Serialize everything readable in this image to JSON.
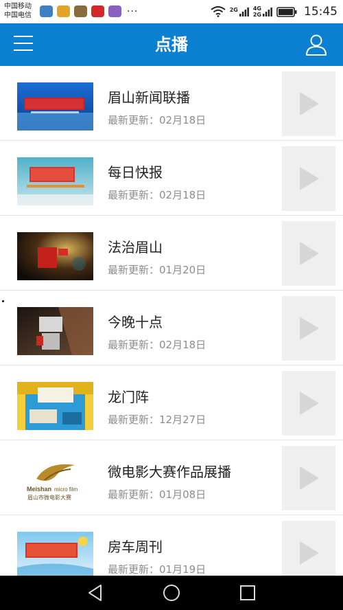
{
  "status_bar": {
    "carrier_1": "中国移动",
    "carrier_2": "中国电信",
    "more": "···",
    "signal_1_label": "2G",
    "signal_2_label_top": "4G",
    "signal_2_label_bottom": "2G",
    "time": "15:45"
  },
  "app_bar": {
    "title": "点播",
    "menu_icon": "menu-icon",
    "user_icon": "user-icon",
    "color": "#0b7fd0"
  },
  "programs": [
    {
      "title": "眉山新闻联播",
      "update_label": "最新更新：02月18日"
    },
    {
      "title": "每日快报",
      "update_label": "最新更新：02月18日"
    },
    {
      "title": "法治眉山",
      "update_label": "最新更新：01月20日"
    },
    {
      "title": "今晚十点",
      "update_label": "最新更新：02月18日"
    },
    {
      "title": "龙门阵",
      "update_label": "最新更新：12月27日"
    },
    {
      "title": "微电影大赛作品展播",
      "update_label": "最新更新：01月08日"
    },
    {
      "title": "房车周刊",
      "update_label": "最新更新：01月19日"
    }
  ],
  "thumb_text": {
    "meishan_logo": "Meishan",
    "meishan_logo_sub": "micro film",
    "meishan_logo_cn": "眉山市微电影大赛"
  },
  "nav_bar": {
    "back_icon": "back-icon",
    "home_icon": "home-icon",
    "recents_icon": "recents-icon"
  }
}
